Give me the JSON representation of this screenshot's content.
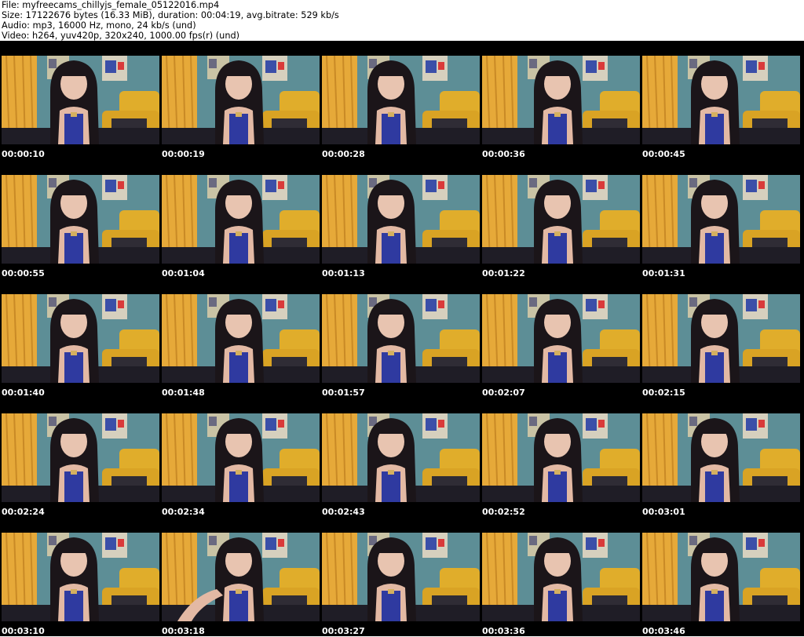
{
  "header": {
    "line1": "File: myfreecams_chillyjs_female_05122016.mp4",
    "line2": "Size: 17122676 bytes (16.33 MiB), duration: 00:04:19, avg.bitrate: 529 kb/s",
    "line3": "Audio: mp3, 16000 Hz, mono, 24 kb/s (und)",
    "line4": "Video: h264, yuv420p, 320x240, 1000.00 fps(r) (und)"
  },
  "thumbnails": [
    "00:00:10",
    "00:00:19",
    "00:00:28",
    "00:00:36",
    "00:00:45",
    "00:00:55",
    "00:01:04",
    "00:01:13",
    "00:01:22",
    "00:01:31",
    "00:01:40",
    "00:01:48",
    "00:01:57",
    "00:02:07",
    "00:02:15",
    "00:02:24",
    "00:02:34",
    "00:02:43",
    "00:02:52",
    "00:03:01",
    "00:03:10",
    "00:03:18",
    "00:03:27",
    "00:03:36",
    "00:03:46"
  ]
}
